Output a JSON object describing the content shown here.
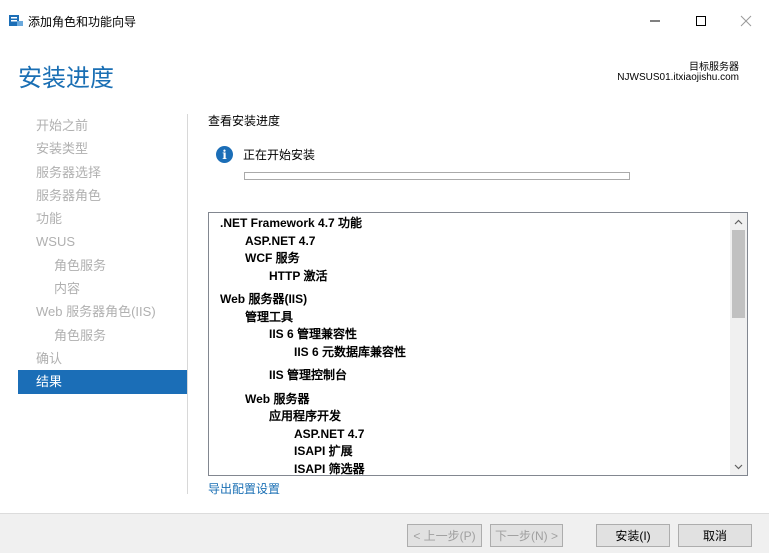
{
  "window": {
    "title": "添加角色和功能向导"
  },
  "header": {
    "page_title": "安装进度",
    "target_label": "目标服务器",
    "target_server": "NJWSUS01.itxiaojishu.com"
  },
  "nav": {
    "items": [
      {
        "label": "开始之前"
      },
      {
        "label": "安装类型"
      },
      {
        "label": "服务器选择"
      },
      {
        "label": "服务器角色"
      },
      {
        "label": "功能"
      },
      {
        "label": "WSUS"
      },
      {
        "label": "角色服务"
      },
      {
        "label": "内容"
      },
      {
        "label": "Web 服务器角色(IIS)"
      },
      {
        "label": "角色服务"
      },
      {
        "label": "确认"
      },
      {
        "label": "结果"
      }
    ],
    "active": "结果"
  },
  "content": {
    "section_label": "查看安装进度",
    "status_text": "正在开始安装",
    "progress": 0
  },
  "features": [
    {
      "label": ".NET Framework 4.7 功能"
    },
    {
      "label": "ASP.NET 4.7"
    },
    {
      "label": "WCF 服务"
    },
    {
      "label": "HTTP 激活"
    },
    {
      "label": "Web 服务器(IIS)"
    },
    {
      "label": "管理工具"
    },
    {
      "label": "IIS 6 管理兼容性"
    },
    {
      "label": "IIS 6 元数据库兼容性"
    },
    {
      "label": "IIS 管理控制台"
    },
    {
      "label": "Web 服务器"
    },
    {
      "label": "应用程序开发"
    },
    {
      "label": "ASP.NET 4.7"
    },
    {
      "label": "ISAPI 扩展"
    },
    {
      "label": "ISAPI 筛选器"
    }
  ],
  "export_link": "导出配置设置",
  "footer": {
    "prev": "< 上一步(P)",
    "next": "下一步(N) >",
    "install": "安装(I)",
    "cancel": "取消"
  },
  "colors": {
    "accent": "#1b6eb7",
    "title_blue": "#1a6fb4",
    "progress_green": "#06b025"
  }
}
